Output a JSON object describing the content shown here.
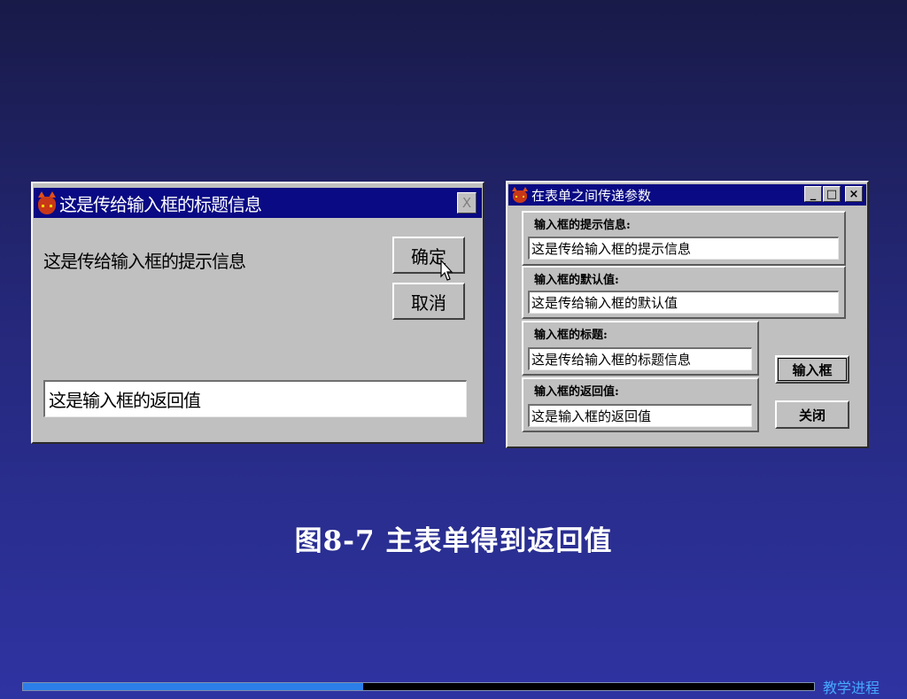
{
  "dialog": {
    "title": "这是传给输入框的标题信息",
    "prompt": "这是传给输入框的提示信息",
    "ok_label": "确定",
    "cancel_label": "取消",
    "close_glyph": "X",
    "input_value": "这是输入框的返回值"
  },
  "form": {
    "title": "在表单之间传递参数",
    "controls": {
      "minimize": "_",
      "maximize": "□",
      "close": "×"
    },
    "groups": [
      {
        "label": "输入框的提示信息:",
        "value": "这是传给输入框的提示信息"
      },
      {
        "label": "输入框的默认值:",
        "value": "这是传给输入框的默认值"
      },
      {
        "label": "输入框的标题:",
        "value": "这是传给输入框的标题信息"
      },
      {
        "label": "输入框的返回值:",
        "value": "这是输入框的返回值"
      }
    ],
    "input_box_button": "输入框",
    "close_button": "关闭"
  },
  "caption": "图8-7  主表单得到返回值",
  "footer": {
    "nav_label": "教学进程",
    "progress": 0.43,
    "progress_color": "#2c7fe8"
  },
  "colors": {
    "titlebar": "#0a0a84",
    "window_face": "#c0c0c0"
  }
}
